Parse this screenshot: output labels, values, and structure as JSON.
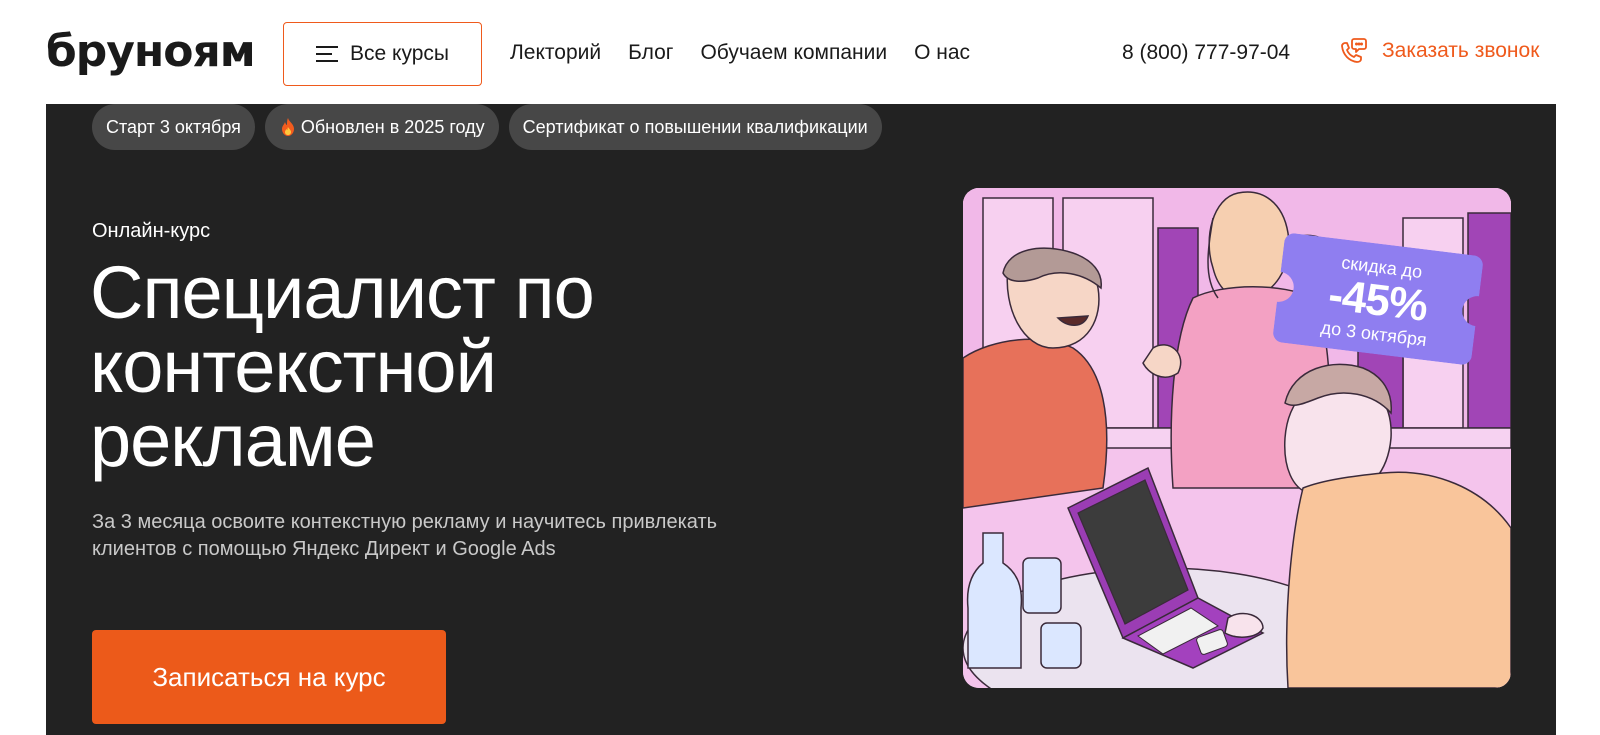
{
  "header": {
    "logo": "бруноям",
    "all_courses_label": "Все курсы",
    "nav": [
      "Лекторий",
      "Блог",
      "Обучаем компании",
      "О нас"
    ],
    "phone": "8 (800) 777-97-04",
    "callback_label": "Заказать звонок"
  },
  "hero": {
    "tags": [
      "Старт 3 октября",
      "Обновлен в 2025 году",
      "Сертификат о повышении квалификации"
    ],
    "kicker": "Онлайн-курс",
    "title": "Специалист по контекстной рекламе",
    "subtitle": "За 3 месяца освоите контекстную рекламу и научитесь привлекать клиентов с помощью Яндекс Директ и Google Ads",
    "cta_label": "Записаться на курс",
    "discount": {
      "top": "скидка до",
      "value": "-45%",
      "bottom": "до 3 октября"
    }
  },
  "colors": {
    "accent": "#ef5a1c",
    "hero_bg": "#222222",
    "tag_bg": "#474747",
    "discount_bg": "#8f7ef0"
  },
  "icons": {
    "menu": "burger-icon",
    "fire": "fire-icon",
    "phone": "phone-chat-icon"
  }
}
